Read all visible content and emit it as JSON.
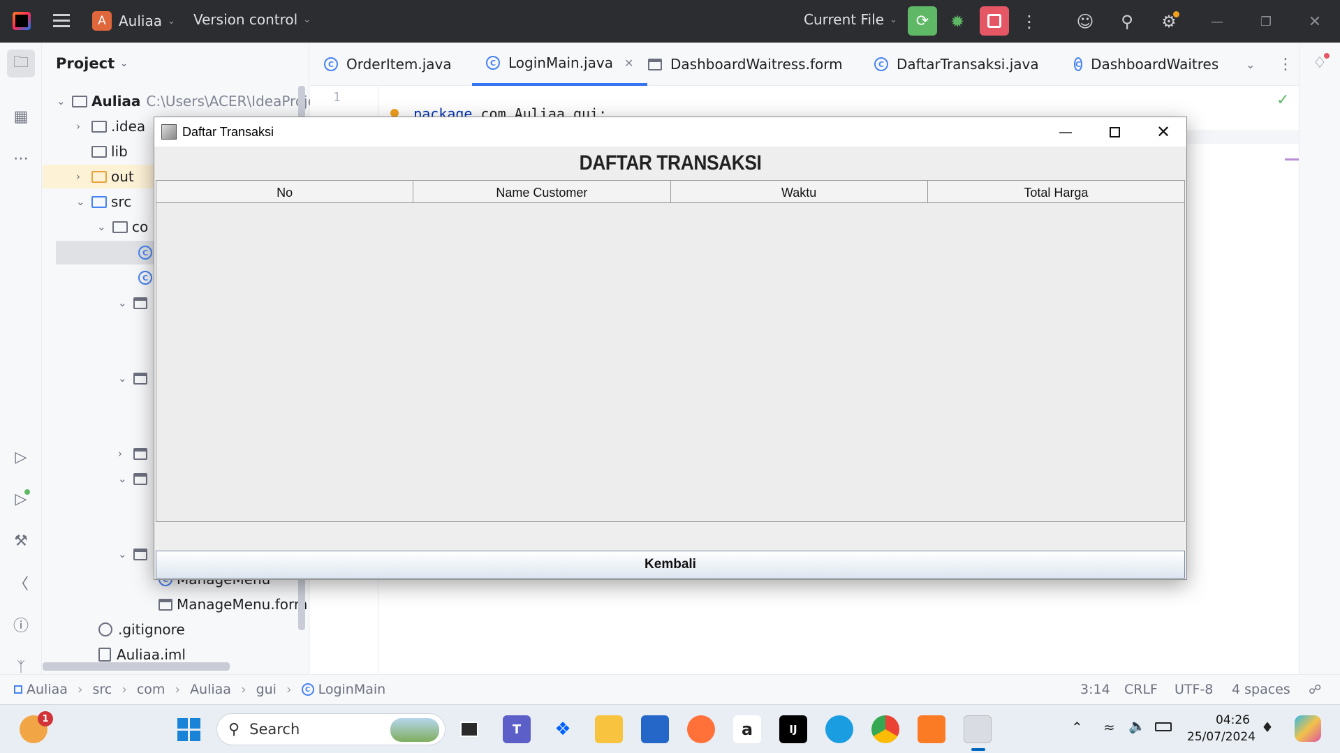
{
  "ide": {
    "project_name": "Auliaa",
    "version_control": "Version control",
    "run_config": "Current File",
    "avatar_letter": "A"
  },
  "project_panel": {
    "title": "Project",
    "root_name": "Auliaa",
    "root_path": "C:\\Users\\ACER\\IdeaProje",
    "items": {
      "idea": ".idea",
      "lib": "lib",
      "out": "out",
      "src": "src",
      "com": "co",
      "manage_menu": "ManageMenu",
      "manage_menu_form": "ManageMenu.form",
      "gitignore": ".gitignore",
      "iml": "Auliaa.iml"
    }
  },
  "tabs": [
    {
      "label": "OrderItem.java"
    },
    {
      "label": "LoginMain.java"
    },
    {
      "label": "DashboardWaitress.form"
    },
    {
      "label": "DaftarTransaksi.java"
    },
    {
      "label": "DashboardWaitress.j"
    }
  ],
  "editor": {
    "line_number": "1",
    "keyword": "package",
    "code_rest": " com.Auliaa.gui;"
  },
  "statusbar": {
    "breadcrumbs": [
      "Auliaa",
      "src",
      "com",
      "Auliaa",
      "gui",
      "LoginMain"
    ],
    "position": "3:14",
    "line_sep": "CRLF",
    "encoding": "UTF-8",
    "indent": "4 spaces"
  },
  "swing_window": {
    "title": "Daftar Transaksi",
    "heading": "DAFTAR TRANSAKSI",
    "columns": [
      "No",
      "Name Customer",
      "Waktu",
      "Total Harga"
    ],
    "button_label": "Kembali"
  },
  "taskbar": {
    "search_placeholder": "Search",
    "time": "04:26",
    "date": "25/07/2024",
    "weather_badge": "1"
  },
  "colors": {
    "accent": "#3574f0",
    "run_green": "#5fb865",
    "stop_red": "#e55765",
    "titlebar_bg": "#2b2d30"
  }
}
